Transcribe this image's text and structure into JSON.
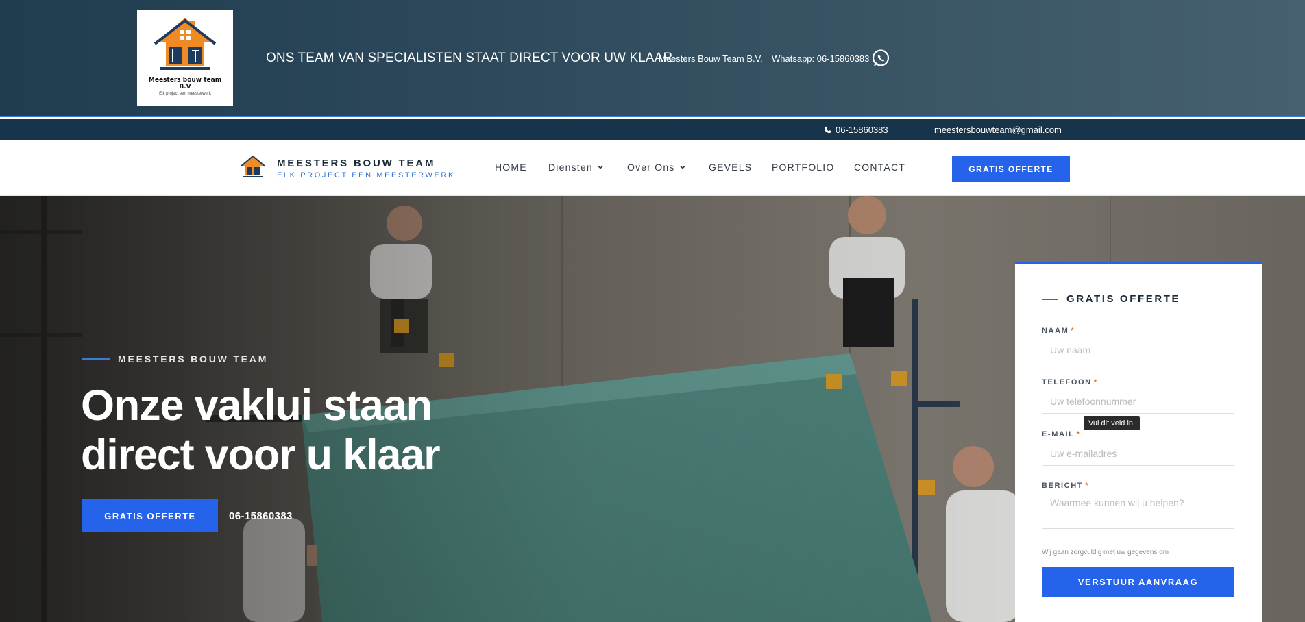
{
  "banner": {
    "logo_name": "Meesters bouw team B.V",
    "logo_sub": "Elk project een meesterwerk",
    "tagline": "ONS TEAM VAN SPECIALISTEN STAAT DIRECT VOOR UW KLAAR",
    "company": "Meesters Bouw Team B.V.",
    "whatsapp": "Whatsapp: 06-15860383"
  },
  "infobar": {
    "phone": "06-15860383",
    "email": "meestersbouwteam@gmail.com"
  },
  "nav": {
    "brand": "MEESTERS BOUW TEAM",
    "slogan": "ELK PROJECT EEN MEESTERWERK",
    "items": [
      {
        "label": "HOME",
        "dropdown": false
      },
      {
        "label": "Diensten",
        "dropdown": true
      },
      {
        "label": "Over Ons",
        "dropdown": true
      },
      {
        "label": "GEVELS",
        "dropdown": false
      },
      {
        "label": "PORTFOLIO",
        "dropdown": false
      },
      {
        "label": "CONTACT",
        "dropdown": false
      }
    ],
    "cta": "GRATIS OFFERTE"
  },
  "hero": {
    "kicker": "MEESTERS BOUW TEAM",
    "title": "Onze vaklui staan direct voor u klaar",
    "cta": "GRATIS OFFERTE",
    "phone": "06-15860383"
  },
  "form": {
    "heading": "GRATIS OFFERTE",
    "name_label": "NAAM",
    "name_placeholder": "Uw naam",
    "phone_label": "TELEFOON",
    "phone_placeholder": "Uw telefoonnummer",
    "tooltip": "Vul dit veld in.",
    "email_label": "E-MAIL",
    "email_placeholder": "Uw e-mailadres",
    "message_label": "BERICHT",
    "message_placeholder": "Waarmee kunnen wij u helpen?",
    "required_mark": "*",
    "privacy": "Wij gaan zorgvuldig met uw gegevens om",
    "submit": "VERSTUUR AANVRAAG"
  },
  "colors": {
    "accent": "#2563eb",
    "banner_dark": "#1f3d4f",
    "infobar": "#18344a",
    "logo_orange": "#f08a24",
    "logo_navy": "#1e3a5f"
  },
  "icons": [
    "whatsapp-icon",
    "phone-icon",
    "chevron-down-icon",
    "house-logo-icon"
  ]
}
